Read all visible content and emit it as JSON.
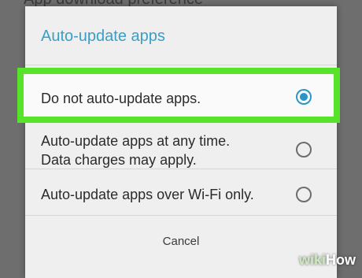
{
  "background": {
    "partial_text": "App download preference"
  },
  "dialog": {
    "title": "Auto-update apps",
    "options": [
      {
        "label": "Do not auto-update apps.",
        "selected": true
      },
      {
        "label_line1": "Auto-update apps at any time.",
        "label_line2": "Data charges may apply.",
        "selected": false
      },
      {
        "label": "Auto-update apps over Wi-Fi only.",
        "selected": false
      }
    ],
    "cancel_label": "Cancel"
  },
  "watermark": {
    "part1": "wiki",
    "part2": "How"
  },
  "colors": {
    "accent": "#2a96c8",
    "highlight": "#57e32a",
    "title": "#3a9fc6"
  }
}
